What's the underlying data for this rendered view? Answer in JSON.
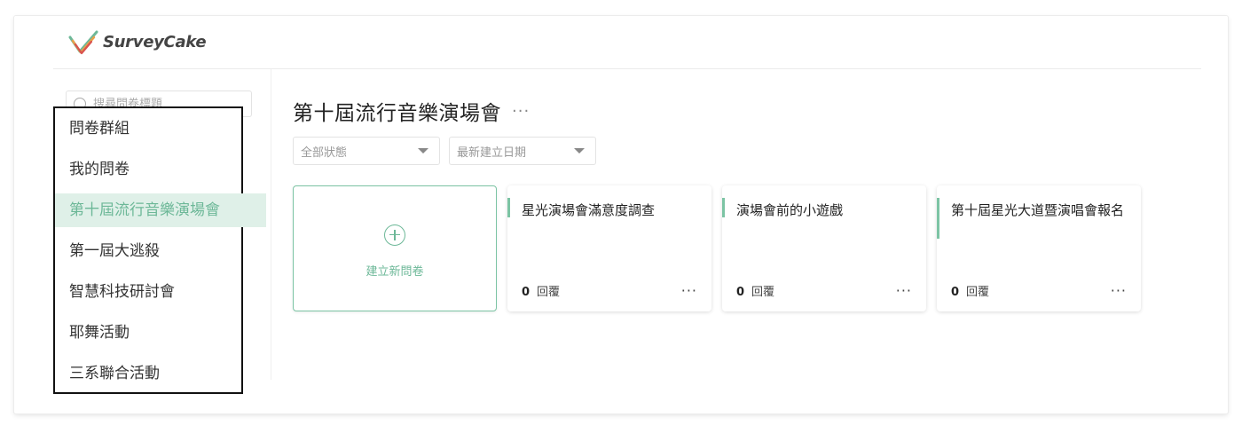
{
  "app": {
    "name": "SurveyCake",
    "accent": "#6db898"
  },
  "sidebar": {
    "search_placeholder": "搜尋問卷標題",
    "items": [
      {
        "label": "問卷群組"
      },
      {
        "label": "我的問卷"
      },
      {
        "label": "第十屆流行音樂演場會",
        "active": true
      },
      {
        "label": "第一屆大逃殺"
      },
      {
        "label": "智慧科技研討會"
      },
      {
        "label": "耶舞活動"
      },
      {
        "label": "三系聯合活動"
      }
    ]
  },
  "main": {
    "title": "第十屆流行音樂演場會",
    "filters": {
      "status": "全部狀態",
      "sort": "最新建立日期"
    },
    "new_card_label": "建立新問卷",
    "cards": [
      {
        "title": "星光演場會滿意度調查",
        "count": "0",
        "resp_label": "回覆"
      },
      {
        "title": "演場會前的小遊戲",
        "count": "0",
        "resp_label": "回覆"
      },
      {
        "title": "第十屆星光大道暨演唱會報名",
        "count": "0",
        "resp_label": "回覆"
      }
    ]
  }
}
